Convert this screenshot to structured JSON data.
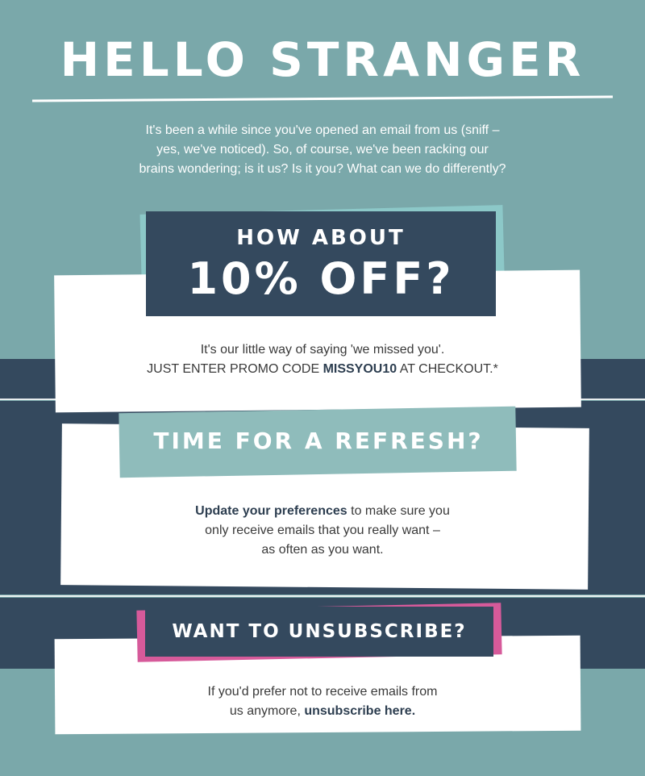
{
  "header": {
    "title": "HELLO STRANGER",
    "intro_line1": "It's been a while since you've opened an email from us (sniff –",
    "intro_line2": "yes, we've noticed). So, of course, we've been racking our",
    "intro_line3": "brains wondering; is it us? Is it you? What can we do differently?"
  },
  "offer": {
    "heading_small": "HOW ABOUT",
    "heading_big": "10% OFF?",
    "line1": "It's our little way of saying 'we missed you'.",
    "line2_prefix": "JUST ENTER PROMO CODE ",
    "promo_code": "MISSYOU10",
    "line2_suffix": " AT CHECKOUT.*"
  },
  "refresh": {
    "heading": "TIME FOR A REFRESH?",
    "link_text": "Update your preferences",
    "line1_rest": " to make sure you",
    "line2": "only receive emails that you really want –",
    "line3": "as often as you want."
  },
  "unsubscribe": {
    "heading": "WANT TO UNSUBSCRIBE?",
    "line1": "If you'd prefer not to receive emails from",
    "line2_prefix": "us anymore, ",
    "link_text": "unsubscribe here."
  },
  "colors": {
    "teal": "#7aa8aa",
    "light_teal": "#8cc8c8",
    "navy": "#34495e",
    "pink": "#d65a9a",
    "white": "#ffffff"
  }
}
